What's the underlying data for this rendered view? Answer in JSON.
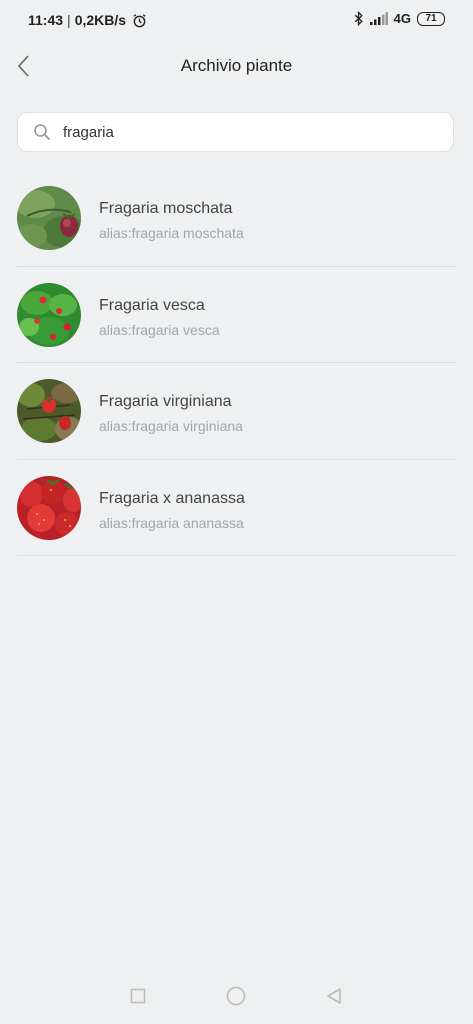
{
  "status_bar": {
    "time": "11:43",
    "separator": "|",
    "net_speed": "0,2KB/s",
    "network": "4G",
    "battery": "71"
  },
  "header": {
    "title": "Archivio piante"
  },
  "search": {
    "value": "fragaria"
  },
  "results": [
    {
      "name": "Fragaria moschata",
      "alias": "alias:fragaria moschata"
    },
    {
      "name": "Fragaria vesca",
      "alias": "alias:fragaria vesca"
    },
    {
      "name": "Fragaria virginiana",
      "alias": "alias:fragaria virginiana"
    },
    {
      "name": "Fragaria x ananassa",
      "alias": "alias:fragaria ananassa"
    }
  ],
  "colors": {
    "background": "#eef0f1",
    "divider": "#d9dcde",
    "alias_text": "#a3a6a9"
  }
}
